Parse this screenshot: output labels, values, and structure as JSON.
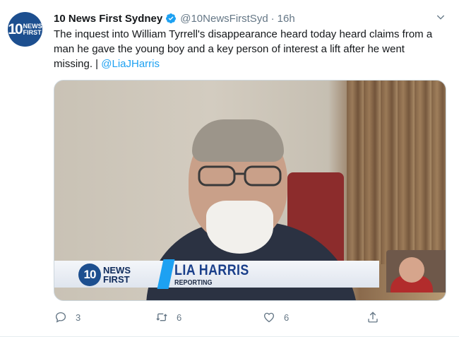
{
  "tweet": {
    "author_name": "10 News First Sydney",
    "handle": "@10NewsFirstSyd",
    "separator": "·",
    "time": "16h",
    "text": "The inquest into William Tyrrell's disappearance heard today heard claims from a man he gave the young boy and a key person of interest a lift after he went missing. |",
    "mention": "@LiaJHarris",
    "avatar_logo": {
      "number": "10",
      "line1": "NEWS",
      "line2": "FIRST"
    }
  },
  "video": {
    "lower_third": {
      "logo_number": "10",
      "logo_line1": "NEWS",
      "logo_line2": "FIRST",
      "reporter_name": "LIA HARRIS",
      "role": "REPORTING"
    }
  },
  "actions": {
    "reply_count": "3",
    "retweet_count": "6",
    "like_count": "6"
  },
  "icons": {
    "verified": "verified-badge-icon",
    "menu": "chevron-down-icon",
    "reply": "reply-icon",
    "retweet": "retweet-icon",
    "like": "heart-icon",
    "share": "share-icon"
  },
  "colors": {
    "accent": "#1da1f2",
    "secondary_text": "#657786",
    "primary_text": "#14171a"
  }
}
